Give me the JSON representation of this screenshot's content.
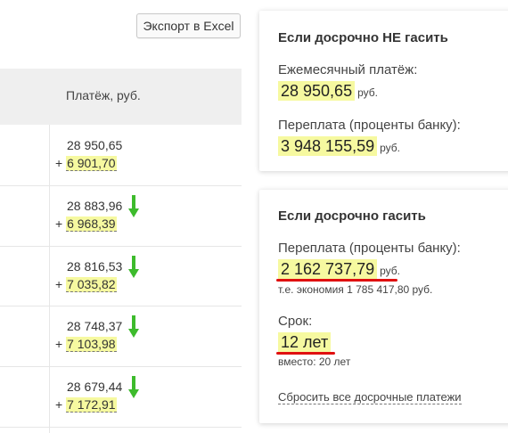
{
  "toolbar": {
    "export_label": "Экспорт в Excel"
  },
  "table": {
    "payment_header": "Платёж, руб.",
    "rows": [
      {
        "base": "28 950,65",
        "extra_sign": "+ ",
        "extra": "6 901,70",
        "arrow": false
      },
      {
        "base": "28 883,96",
        "extra_sign": "+ ",
        "extra": "6 968,39",
        "arrow": true
      },
      {
        "base": "28 816,53",
        "extra_sign": "+ ",
        "extra": "7 035,82",
        "arrow": true
      },
      {
        "base": "28 748,37",
        "extra_sign": "+ ",
        "extra": "7 103,98",
        "arrow": true
      },
      {
        "base": "28 679,44",
        "extra_sign": "+ ",
        "extra": "7 172,91",
        "arrow": true
      }
    ]
  },
  "no_prepay_card": {
    "title": "Если досрочно НЕ гасить",
    "monthly_label": "Ежемесячный платёж:",
    "monthly_value": "28 950,65",
    "monthly_unit": "руб.",
    "overpay_label": "Переплата (проценты банку):",
    "overpay_value": "3 948 155,59",
    "overpay_unit": "руб."
  },
  "prepay_card": {
    "title": "Если досрочно гасить",
    "overpay_label": "Переплата (проценты банку):",
    "overpay_value": "2 162 737,79",
    "overpay_unit": "руб.",
    "savings_note": "т.е. экономия 1 785 417,80 руб.",
    "term_label": "Срок:",
    "term_value": "12 лет",
    "term_note": "вместо: 20 лет",
    "reset_link": "Сбросить все досрочные платежи"
  },
  "colors": {
    "highlight": "#f6f9a0",
    "arrow_green": "#3dbb2c",
    "underline_red": "#e01010"
  },
  "icons": {
    "decrease": "arrow-down-icon"
  }
}
